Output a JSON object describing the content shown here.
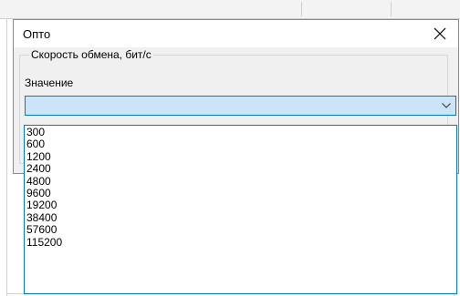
{
  "dialog": {
    "title": "Опто",
    "group_label": "Скорость обмена, бит/с",
    "field_label": "Значение",
    "selected_value": ""
  },
  "dropdown": {
    "options": [
      "300",
      "600",
      "1200",
      "2400",
      "4800",
      "9600",
      "19200",
      "38400",
      "57600",
      "115200"
    ]
  },
  "icons": {
    "close": "close-icon",
    "dropdown_arrow": "chevron-down-icon"
  },
  "colors": {
    "accent": "#0078d7",
    "combo_highlight": "#cce4f7",
    "dialog_bg": "#f0f0f0"
  }
}
